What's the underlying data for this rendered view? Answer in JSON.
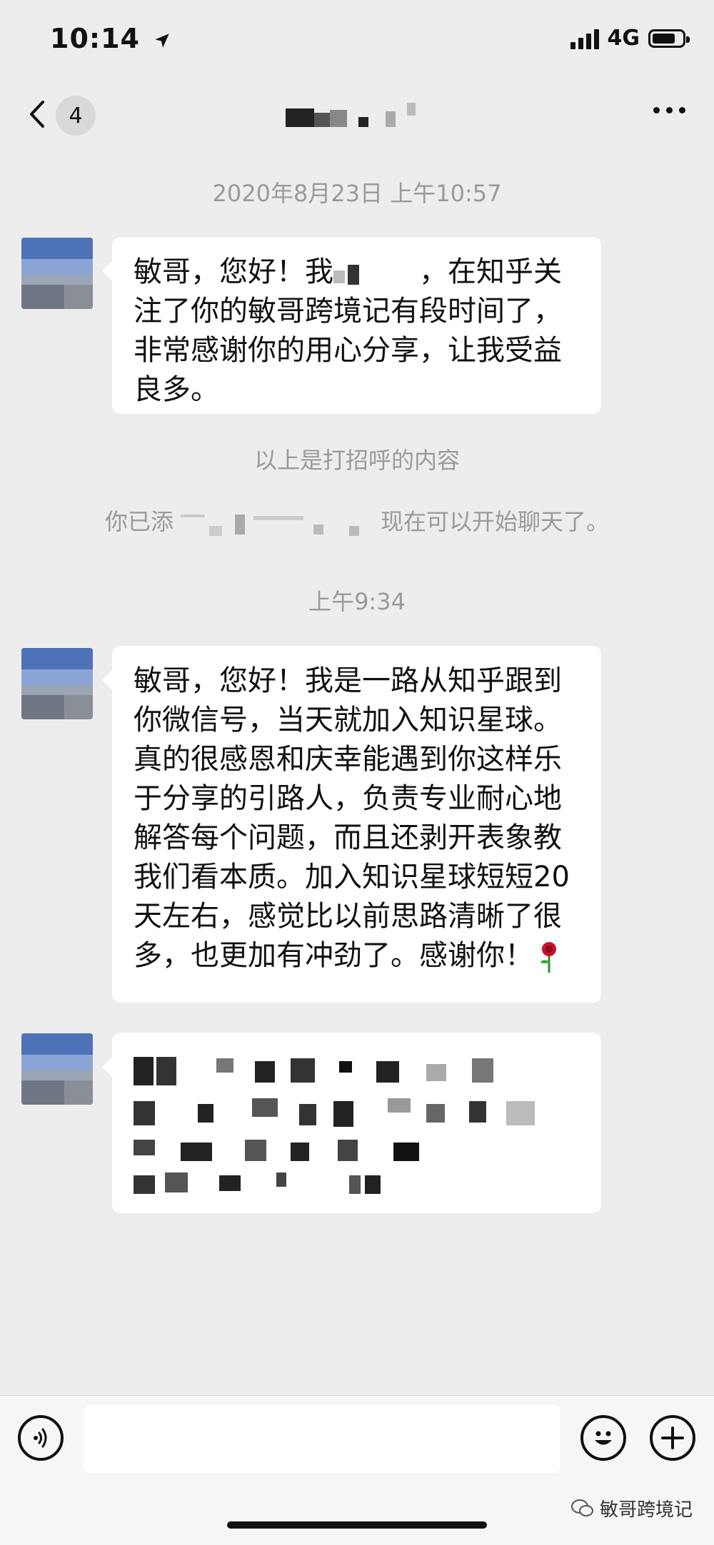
{
  "status": {
    "time": "10:14",
    "network": "4G"
  },
  "nav": {
    "unread_count": "4"
  },
  "timestamps": {
    "first": "2020年8月23日 上午10:57",
    "second": "上午9:34"
  },
  "messages": [
    "敏哥，您好！我",
    "，在知乎关注了你的敏哥跨境记有段时间了，非常感谢你的用心分享，让我受益良多。",
    "敏哥，您好！我是一路从知乎跟到你微信号，当天就加入知识星球。真的很感恩和庆幸能遇到你这样乐于分享的引路人，负责专业耐心地解答每个问题，而且还剥开表象教我们看本质。加入知识星球短短20天左右，感觉比以前思路清晰了很多，也更加有冲劲了。感谢你！"
  ],
  "system": {
    "greeting_note": "以上是打招呼的内容",
    "added_prefix": "你已添",
    "added_suffix": "现在可以开始聊天了。"
  },
  "watermark": "敏哥跨境记",
  "icons": [
    "back-chevron-icon",
    "more-dots-icon",
    "voice-icon",
    "emoji-icon",
    "plus-icon",
    "location-arrow-icon",
    "rose-emoji-icon",
    "wechat-logo-icon"
  ]
}
